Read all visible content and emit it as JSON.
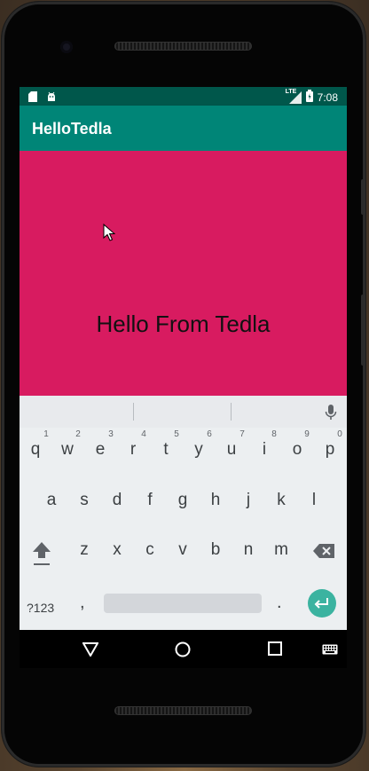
{
  "status_bar": {
    "time": "7:08",
    "network": "LTE"
  },
  "app": {
    "title": "HelloTedla"
  },
  "content": {
    "message": "Hello From Tedla",
    "background": "#d81b60"
  },
  "keyboard": {
    "number_hints": [
      "1",
      "2",
      "3",
      "4",
      "5",
      "6",
      "7",
      "8",
      "9",
      "0"
    ],
    "row1": [
      "q",
      "w",
      "e",
      "r",
      "t",
      "y",
      "u",
      "i",
      "o",
      "p"
    ],
    "row2": [
      "a",
      "s",
      "d",
      "f",
      "g",
      "h",
      "j",
      "k",
      "l"
    ],
    "row3": [
      "z",
      "x",
      "c",
      "v",
      "b",
      "n",
      "m"
    ],
    "symbols_label": "?123",
    "comma": ",",
    "period": ".",
    "icons": [
      "shift-icon",
      "backspace-icon",
      "mic-icon",
      "enter-icon"
    ]
  },
  "navbar": {
    "icons": [
      "back-icon",
      "home-icon",
      "recents-icon",
      "keyboard-switch-icon"
    ]
  },
  "colors": {
    "status_bar": "#00574b",
    "app_bar": "#008577",
    "accent": "#3bb3a0"
  }
}
